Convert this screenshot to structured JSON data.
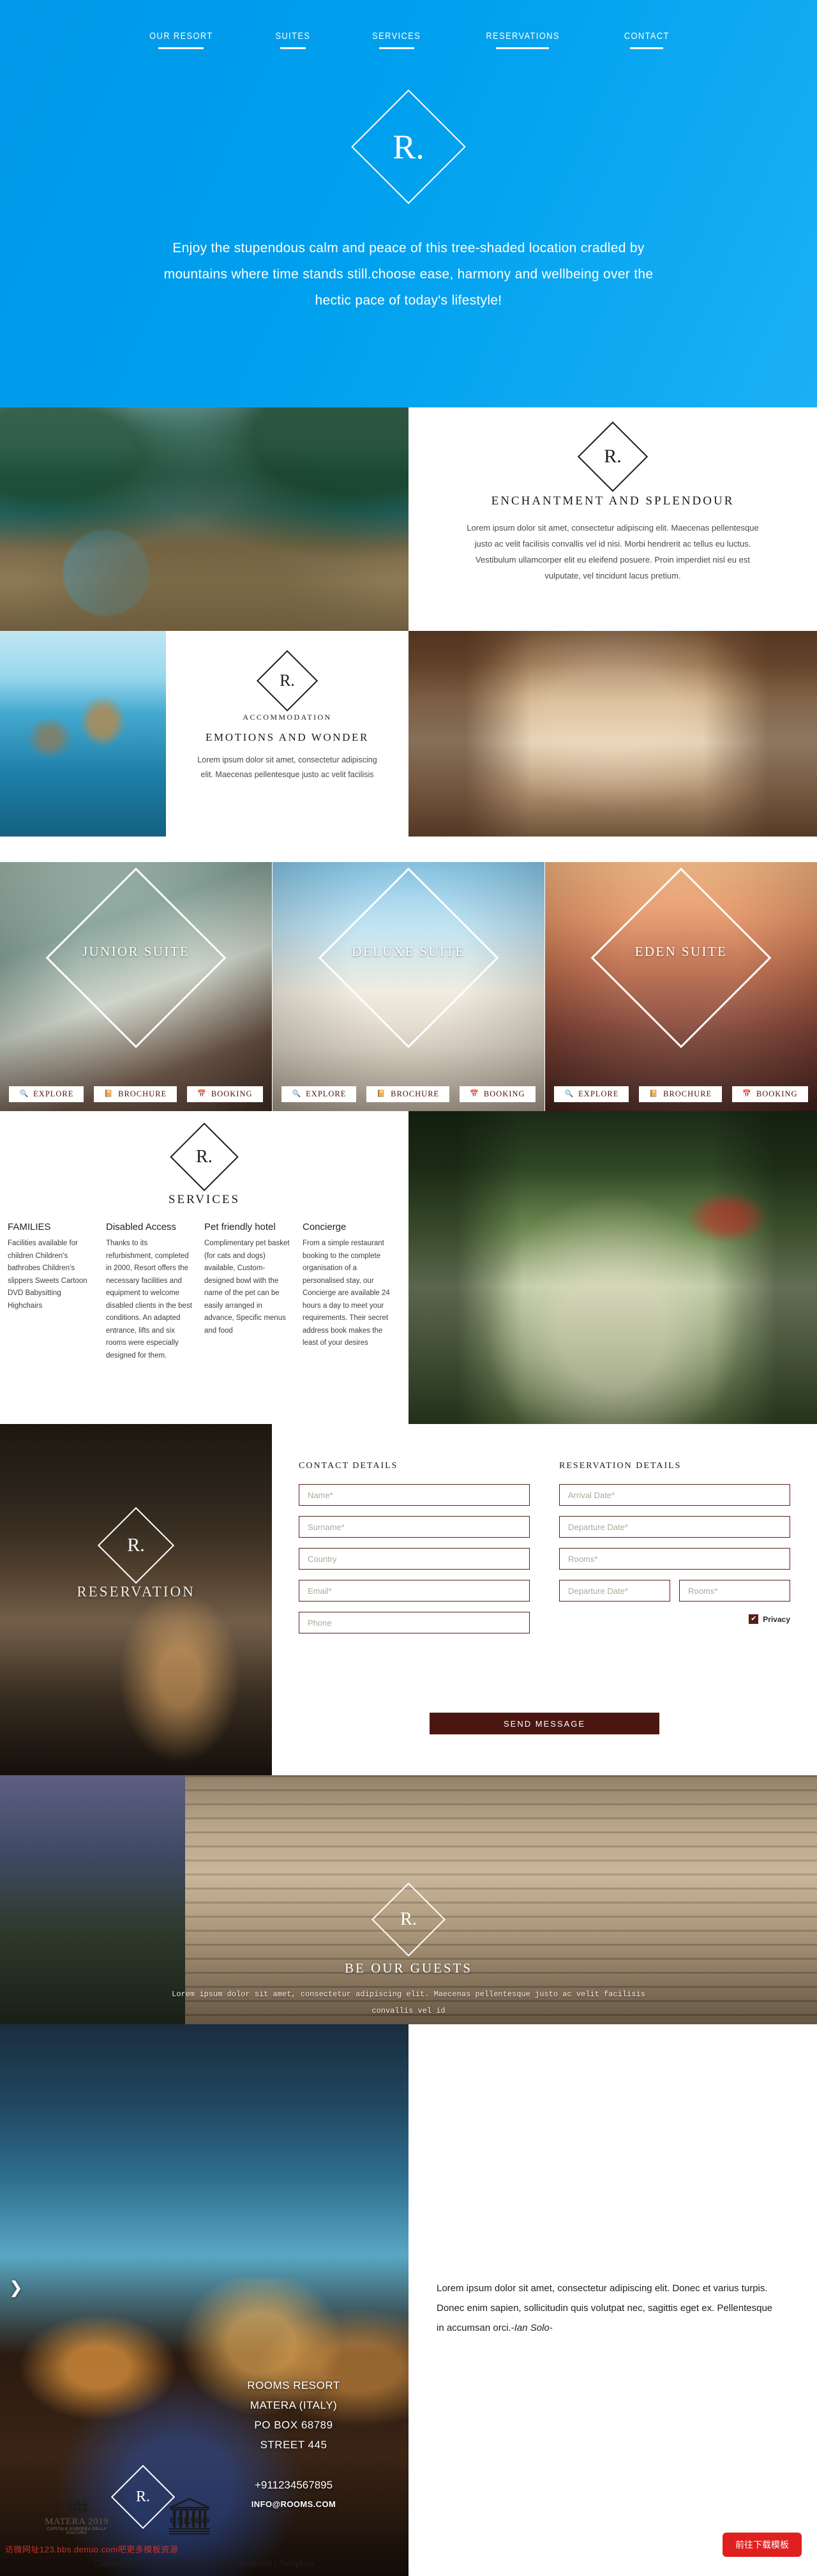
{
  "brand": {
    "monogram": "R.",
    "accent_blue": "#0098e8",
    "accent_maroon": "#4b1611",
    "download_red": "#e01f1f"
  },
  "nav": {
    "items": [
      {
        "label": "OUR RESORT"
      },
      {
        "label": "SUITES"
      },
      {
        "label": "SERVICES"
      },
      {
        "label": "RESERVATIONS"
      },
      {
        "label": "CONTACT"
      }
    ]
  },
  "hero": {
    "tagline": "Enjoy the stupendous calm and peace of this tree-shaded location cradled by mountains where time stands still.choose ease, harmony and wellbeing over the hectic pace of today's lifestyle!"
  },
  "enchantment": {
    "title": "ENCHANTMENT  AND  SPLENDOUR",
    "body": "Lorem ipsum dolor sit amet, consectetur adipiscing elit. Maecenas pellentesque justo ac velit facilisis convallis vel id nisi. Morbi hendrerit ac tellus eu luctus. Vestibulum ullamcorper elit eu eleifend posuere. Proin imperdiet nisl eu est vulputate, vel tincidunt lacus pretium."
  },
  "accommodation": {
    "kicker": "ACCOMMODATION",
    "title": "EMOTIONS  AND  WONDER",
    "body": "Lorem ipsum dolor sit amet, consectetur adipiscing elit. Maecenas pellentesque justo ac velit facilisis"
  },
  "suites": {
    "buttons": {
      "explore": "EXPLORE",
      "brochure": "BROCHURE",
      "booking": "BOOKING"
    },
    "icons": {
      "explore": "search-icon",
      "brochure": "book-icon",
      "booking": "calendar-icon"
    },
    "items": [
      {
        "label": "JUNIOR SUITE"
      },
      {
        "label": "DELUXE SUITE"
      },
      {
        "label": "EDEN SUITE"
      }
    ]
  },
  "services": {
    "title": "SERVICES",
    "columns": [
      {
        "heading": "FAMILIES",
        "body": "Facilities available for children Children's bathrobes Children's slippers Sweets Cartoon DVD Babysitting Highchairs"
      },
      {
        "heading": "Disabled Access",
        "body": "Thanks to its refurbishment, completed in 2000, Resort offers the necessary facilities and equipment to welcome disabled clients in the best conditions. An adapted entrance, lifts and six rooms were especially designed for them."
      },
      {
        "heading": "Pet friendly hotel",
        "body": "Complimentary pet basket (for cats and dogs) available, Custom-designed bowl with the name of the pet can be easily arranged in advance, Specific menus and food"
      },
      {
        "heading": "Concierge",
        "body": "From a simple restaurant booking to the complete organisation of a personalised stay, our Concierge are available 24 hours a day to meet your requirements. Their secret address book makes the least of your desires"
      }
    ]
  },
  "reservation": {
    "panel_word": "RESERVATION",
    "contact_heading": "CONTACT DETAILS",
    "reservation_heading": "RESERVATION DETAILS",
    "contact_fields": [
      {
        "name": "name-field",
        "placeholder": "Name*",
        "value": ""
      },
      {
        "name": "surname-field",
        "placeholder": "Surname*",
        "value": ""
      },
      {
        "name": "country-field",
        "placeholder": "Country",
        "value": ""
      },
      {
        "name": "email-field",
        "placeholder": "Email*",
        "value": ""
      },
      {
        "name": "phone-field",
        "placeholder": "Phone",
        "value": ""
      }
    ],
    "reservation_fields": [
      {
        "name": "arrival-date-field",
        "placeholder": "Arrival Date*",
        "value": ""
      },
      {
        "name": "departure-date-field",
        "placeholder": "Departure Date*",
        "value": ""
      },
      {
        "name": "rooms-field",
        "placeholder": "Rooms*",
        "value": ""
      }
    ],
    "split_row": [
      {
        "name": "departure-date-field-2",
        "placeholder": "Departure Date*",
        "value": ""
      },
      {
        "name": "rooms-field-2",
        "placeholder": "Rooms*",
        "value": ""
      }
    ],
    "privacy_label": "Privacy",
    "privacy_checked": true,
    "privacy_check_glyph": "✔",
    "send_label": "SEND MESSAGE"
  },
  "guests": {
    "title": "BE OUR GUESTS",
    "body": "Lorem ipsum dolor sit amet, consectetur adipiscing elit. Maecenas pellentesque justo ac velit facilisis convallis vel id"
  },
  "footer": {
    "prev_arrow": "❯",
    "address_lines": [
      "ROOMS RESORT",
      "MATERA (ITALY)",
      "PO BOX 68789",
      "STREET 445"
    ],
    "phone": "+911234567895",
    "email": "INFO@ROOMS.COM",
    "testimonial": "Lorem ipsum dolor sit amet, consectetur adipiscing elit. Donec et varius turpis. Donec enim sapien, sollicitudin quis volutpat nec, sagittis eget ex. Pellentesque in accumsan orci.-",
    "testimonial_author": "Ian Solo-",
    "matera_name": "MATERA 2019",
    "matera_sub": "CAPITALE EUROPEA DELLA CULTURA",
    "unesco_name": "UNESCO",
    "download_button": "前往下载模板",
    "copyright": "Copyrights © 2015 Riviera All rights reserved | Template",
    "watermark": "访微网址123.bbs.denuo.com吧更多模板资源"
  }
}
